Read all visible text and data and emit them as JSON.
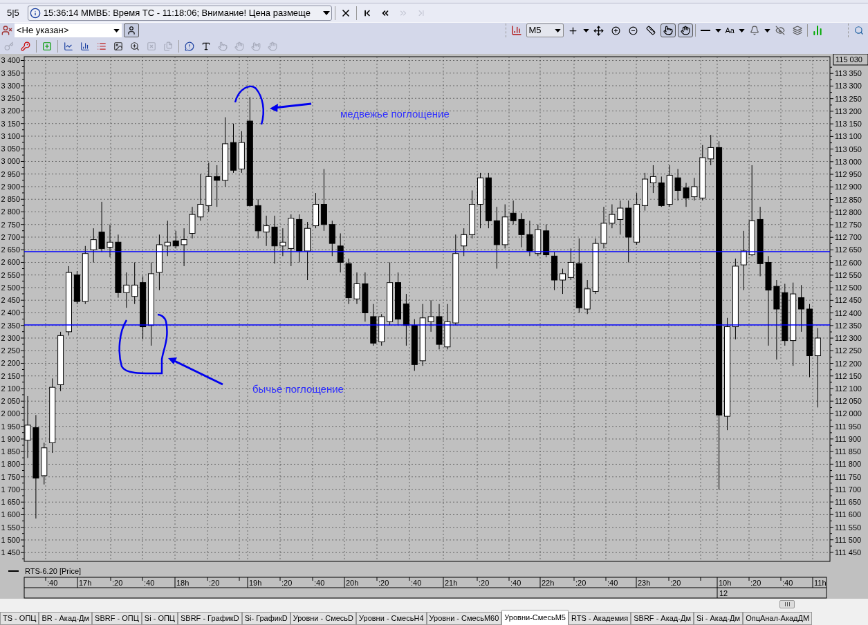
{
  "top_bar": {
    "counter": "5|5",
    "message": "15:36:14  ММВБ: Время ТС - 11:18:06; Внимание! Цена размеще",
    "nav_buttons": [
      {
        "disabled": false
      },
      {
        "disabled": false
      },
      {
        "disabled": true
      },
      {
        "disabled": true
      }
    ]
  },
  "account_bar": {
    "account": "<Не указан>"
  },
  "chart_toolbar": {
    "interval": "M5",
    "font_label": "Aa",
    "pan_modes": [
      {
        "pressed": true
      },
      {
        "pressed": true
      }
    ]
  },
  "tools": [
    {
      "disabled": true
    },
    {
      "disabled": false
    },
    {
      "disabled": false
    },
    {
      "disabled": false
    },
    {
      "disabled": false
    },
    {
      "disabled": false
    },
    {
      "disabled": false
    },
    {
      "disabled": false
    },
    {
      "disabled": true
    },
    {
      "disabled": true
    },
    {
      "disabled": false
    },
    {
      "disabled": false
    },
    {
      "disabled": true
    },
    {
      "disabled": true
    },
    {
      "disabled": true
    },
    {
      "disabled": true
    }
  ],
  "chart": {
    "chart_data": {
      "type": "candlestick",
      "grid": true,
      "ylim": [
        1415,
        3415
      ],
      "yticks": [
        {
          "value": 3400,
          "label": "3 400"
        },
        {
          "value": 3350,
          "label": "3 350"
        },
        {
          "value": 3300,
          "label": "3 300"
        },
        {
          "value": 3250,
          "label": "3 250"
        },
        {
          "value": 3200,
          "label": "3 200"
        },
        {
          "value": 3150,
          "label": "3 150"
        },
        {
          "value": 3100,
          "label": "3 100"
        },
        {
          "value": 3050,
          "label": "3 050"
        },
        {
          "value": 3000,
          "label": "3 000"
        },
        {
          "value": 2950,
          "label": "2 950"
        },
        {
          "value": 2900,
          "label": "2 900"
        },
        {
          "value": 2850,
          "label": "2 850"
        },
        {
          "value": 2800,
          "label": "2 800"
        },
        {
          "value": 2750,
          "label": "2 750"
        },
        {
          "value": 2700,
          "label": "2 700"
        },
        {
          "value": 2650,
          "label": "2 650"
        },
        {
          "value": 2600,
          "label": "2 600"
        },
        {
          "value": 2550,
          "label": "2 550"
        },
        {
          "value": 2500,
          "label": "2 500"
        },
        {
          "value": 2450,
          "label": "2 450"
        },
        {
          "value": 2400,
          "label": "2 400"
        },
        {
          "value": 2350,
          "label": "2 350"
        },
        {
          "value": 2300,
          "label": "2 300"
        },
        {
          "value": 2250,
          "label": "2 250"
        },
        {
          "value": 2200,
          "label": "2 200"
        },
        {
          "value": 2150,
          "label": "2 150"
        },
        {
          "value": 2100,
          "label": "2 100"
        },
        {
          "value": 2050,
          "label": "2 050"
        },
        {
          "value": 2000,
          "label": "2 000"
        },
        {
          "value": 1950,
          "label": "1 950"
        },
        {
          "value": 1900,
          "label": "1 900"
        },
        {
          "value": 1850,
          "label": "1 850"
        },
        {
          "value": 1800,
          "label": "1 800"
        },
        {
          "value": 1750,
          "label": "1 750"
        },
        {
          "value": 1700,
          "label": "1 700"
        },
        {
          "value": 1650,
          "label": "1 650"
        },
        {
          "value": 1600,
          "label": "1 600"
        },
        {
          "value": 1550,
          "label": "1 550"
        },
        {
          "value": 1500,
          "label": "1 500"
        },
        {
          "value": 1450,
          "label": "1 450"
        }
      ],
      "categories": [
        null,
        null,
        null,
        null,
        null,
        null,
        null,
        null,
        null,
        null,
        null,
        null,
        null,
        null,
        null,
        null,
        null,
        null,
        null,
        null,
        null,
        null,
        null,
        null,
        null,
        null,
        null,
        null,
        null,
        null,
        null,
        null,
        null,
        null,
        null,
        null,
        null,
        null,
        null,
        null,
        null,
        null,
        null,
        null,
        null,
        null,
        null,
        null,
        null,
        null,
        null,
        null,
        null,
        null,
        null,
        null,
        null,
        null,
        null,
        null,
        null,
        null,
        null,
        null,
        null,
        null,
        null,
        null,
        null,
        null,
        null,
        null,
        null,
        null,
        null,
        null,
        null,
        null,
        null,
        null,
        null,
        null,
        null,
        null,
        null,
        null,
        null,
        null,
        null,
        null,
        null,
        null,
        null,
        null,
        null,
        null,
        null
      ],
      "ohlc": [
        [
          1895,
          2070,
          1825,
          1955
        ],
        [
          1945,
          1995,
          1585,
          1745
        ],
        [
          1755,
          1885,
          1720,
          1865
        ],
        [
          1885,
          2140,
          1845,
          2105
        ],
        [
          2115,
          2325,
          2090,
          2310
        ],
        [
          2325,
          2585,
          2310,
          2560
        ],
        [
          2550,
          2565,
          2435,
          2445
        ],
        [
          2445,
          2665,
          2435,
          2635
        ],
        [
          2650,
          2735,
          2600,
          2690
        ],
        [
          2720,
          2840,
          2640,
          2655
        ],
        [
          2660,
          2750,
          2620,
          2680
        ],
        [
          2680,
          2710,
          2460,
          2480
        ],
        [
          2480,
          2560,
          2420,
          2510
        ],
        [
          2465,
          2600,
          2435,
          2510
        ],
        [
          2520,
          2545,
          2295,
          2345
        ],
        [
          2350,
          2600,
          2270,
          2555
        ],
        [
          2560,
          2710,
          2490,
          2670
        ],
        [
          2665,
          2765,
          2625,
          2680
        ],
        [
          2685,
          2725,
          2655,
          2665
        ],
        [
          2670,
          2735,
          2585,
          2690
        ],
        [
          2715,
          2820,
          2695,
          2790
        ],
        [
          2780,
          2950,
          2765,
          2830
        ],
        [
          2825,
          2995,
          2800,
          2940
        ],
        [
          2940,
          2985,
          2820,
          2925
        ],
        [
          2925,
          3175,
          2900,
          3070
        ],
        [
          3075,
          3150,
          2955,
          2965
        ],
        [
          2970,
          3120,
          2955,
          3075
        ],
        [
          3160,
          3255,
          2820,
          2825
        ],
        [
          2825,
          2850,
          2695,
          2725
        ],
        [
          2720,
          2785,
          2665,
          2745
        ],
        [
          2740,
          2785,
          2595,
          2665
        ],
        [
          2665,
          2735,
          2625,
          2680
        ],
        [
          2655,
          2790,
          2585,
          2775
        ],
        [
          2770,
          2790,
          2600,
          2645
        ],
        [
          2645,
          2760,
          2530,
          2735
        ],
        [
          2745,
          2875,
          2735,
          2830
        ],
        [
          2830,
          2970,
          2725,
          2750
        ],
        [
          2750,
          2765,
          2625,
          2675
        ],
        [
          2665,
          2715,
          2560,
          2600
        ],
        [
          2595,
          2615,
          2435,
          2460
        ],
        [
          2455,
          2560,
          2435,
          2515
        ],
        [
          2515,
          2560,
          2365,
          2400
        ],
        [
          2385,
          2435,
          2270,
          2280
        ],
        [
          2285,
          2395,
          2270,
          2385
        ],
        [
          2365,
          2600,
          2350,
          2520
        ],
        [
          2520,
          2560,
          2350,
          2375
        ],
        [
          2435,
          2475,
          2270,
          2350
        ],
        [
          2350,
          2375,
          2170,
          2195
        ],
        [
          2210,
          2435,
          2190,
          2380
        ],
        [
          2365,
          2450,
          2325,
          2385
        ],
        [
          2385,
          2435,
          2255,
          2275
        ],
        [
          2265,
          2435,
          2255,
          2365
        ],
        [
          2360,
          2710,
          2350,
          2635
        ],
        [
          2665,
          2735,
          2625,
          2710
        ],
        [
          2710,
          2885,
          2695,
          2830
        ],
        [
          2830,
          2955,
          2735,
          2935
        ],
        [
          2935,
          2955,
          2735,
          2765
        ],
        [
          2765,
          2820,
          2575,
          2670
        ],
        [
          2670,
          2830,
          2655,
          2780
        ],
        [
          2795,
          2845,
          2750,
          2765
        ],
        [
          2770,
          2795,
          2660,
          2710
        ],
        [
          2710,
          2765,
          2625,
          2645
        ],
        [
          2635,
          2750,
          2625,
          2730
        ],
        [
          2725,
          2750,
          2620,
          2630
        ],
        [
          2625,
          2640,
          2490,
          2530
        ],
        [
          2530,
          2575,
          2475,
          2555
        ],
        [
          2540,
          2655,
          2530,
          2600
        ],
        [
          2595,
          2695,
          2400,
          2420
        ],
        [
          2415,
          2530,
          2395,
          2495
        ],
        [
          2485,
          2695,
          2475,
          2675
        ],
        [
          2675,
          2820,
          2655,
          2755
        ],
        [
          2755,
          2830,
          2735,
          2790
        ],
        [
          2770,
          2845,
          2710,
          2815
        ],
        [
          2815,
          2845,
          2600,
          2700
        ],
        [
          2680,
          2875,
          2670,
          2830
        ],
        [
          2825,
          2955,
          2805,
          2930
        ],
        [
          2915,
          2985,
          2875,
          2940
        ],
        [
          2915,
          2940,
          2820,
          2825
        ],
        [
          2830,
          2985,
          2820,
          2945
        ],
        [
          2935,
          2970,
          2845,
          2885
        ],
        [
          2895,
          2915,
          2820,
          2855
        ],
        [
          2860,
          2935,
          2845,
          2900
        ],
        [
          2855,
          3065,
          2845,
          3015
        ],
        [
          3010,
          3105,
          2985,
          3055
        ],
        [
          3055,
          3080,
          1700,
          1995
        ],
        [
          1990,
          2380,
          1935,
          2345
        ],
        [
          2345,
          2615,
          2295,
          2585
        ],
        [
          2590,
          2725,
          2490,
          2645
        ],
        [
          2630,
          2985,
          2625,
          2765
        ],
        [
          2770,
          2820,
          2545,
          2595
        ],
        [
          2600,
          2625,
          2270,
          2490
        ],
        [
          2505,
          2530,
          2215,
          2415
        ],
        [
          2480,
          2515,
          2270,
          2290
        ],
        [
          2290,
          2520,
          2190,
          2475
        ],
        [
          2460,
          2510,
          2325,
          2415
        ],
        [
          2415,
          2435,
          2145,
          2230
        ],
        [
          2230,
          2340,
          2025,
          2300
        ]
      ]
    },
    "price_marker": "115 030",
    "y_right": [
      "113 350",
      "113 300",
      "113 250",
      "113 200",
      "113 150",
      "113 100",
      "113 050",
      "113 000",
      "112 950",
      "112 900",
      "112 850",
      "112 800",
      "112 750",
      "112 700",
      "112 650",
      "112 600",
      "112 550",
      "112 500",
      "112 450",
      "112 400",
      "112 350",
      "112 300",
      "112 250",
      "112 200",
      "112 150",
      "112 100",
      "112 050",
      "112 000",
      "111 950",
      "111 900",
      "111 850",
      "111 800",
      "111 750",
      "111 700",
      "111 650",
      "111 600",
      "111 550",
      "111 500",
      "111 450"
    ],
    "legend": "RTS-6.20 [Price]",
    "time_labels": [
      ":40",
      "17h",
      ":20",
      ":40",
      "18h",
      ":20",
      "19h",
      ":20",
      ":40",
      "20h",
      ":20",
      ":40",
      "21h",
      ":20",
      ":40",
      "22h",
      ":20",
      ":40",
      "23h",
      ":20",
      "10h",
      ":20",
      ":40",
      "11h"
    ],
    "date_label": "12",
    "annotations": [
      "медвежье поглощение",
      "бычье поглощение"
    ]
  },
  "tabs": [
    {
      "label": "TS - ОПЦ",
      "selected": false
    },
    {
      "label": "BR - Акад-Дм",
      "selected": false
    },
    {
      "label": "SBRF - ОПЦ",
      "selected": false
    },
    {
      "label": "Si - ОПЦ",
      "selected": false
    },
    {
      "label": "SBRF - ГрафикD",
      "selected": false
    },
    {
      "label": "Si- ГрафикD",
      "selected": false
    },
    {
      "label": "Уровни - СмесьD",
      "selected": false
    },
    {
      "label": "Уровни - СмесьH4",
      "selected": false
    },
    {
      "label": "Уровни - СмесьM60",
      "selected": false
    },
    {
      "label": "Уровни-СмесьM5",
      "selected": true
    },
    {
      "label": "RTS - Академия",
      "selected": false
    },
    {
      "label": "SBRF - Акад-Дм",
      "selected": false
    },
    {
      "label": "Si - Акад-Дм",
      "selected": false
    },
    {
      "label": "ОпцАнал-АкадДМ",
      "selected": false
    }
  ]
}
